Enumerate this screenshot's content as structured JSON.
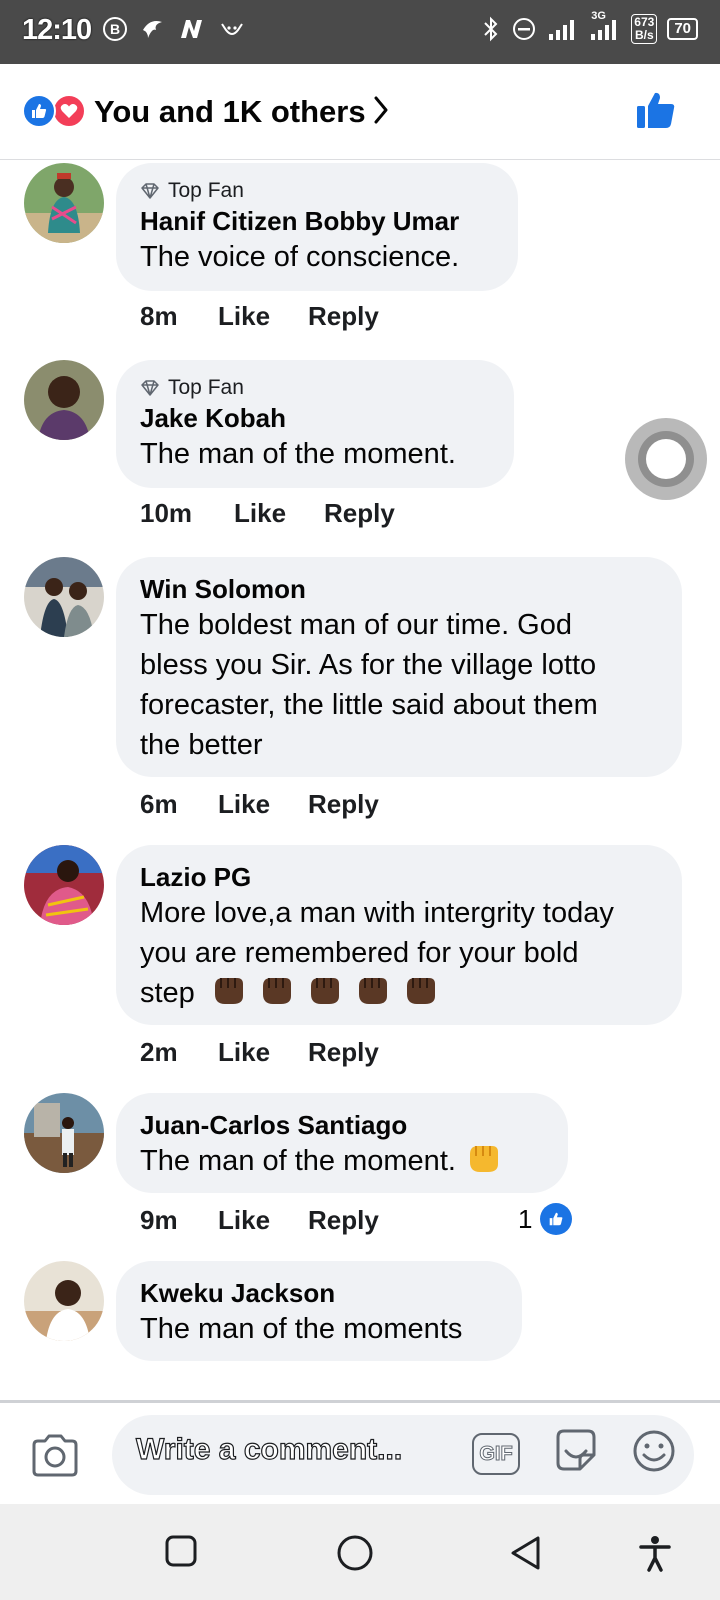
{
  "status_bar": {
    "time": "12:10",
    "network_type": "3G",
    "net_speed_value": "673",
    "net_speed_unit": "B/s",
    "battery": "70"
  },
  "header": {
    "title": "You and 1K others"
  },
  "comments": [
    {
      "badge": "Top Fan",
      "author": "Hanif Citizen Bobby Umar",
      "text": "The voice of conscience.",
      "time": "8m",
      "like": "Like",
      "reply": "Reply"
    },
    {
      "badge": "Top Fan",
      "author": "Jake Kobah",
      "text": "The man of the moment.",
      "time": "10m",
      "like": "Like",
      "reply": "Reply"
    },
    {
      "author": "Win Solomon",
      "text_lines": [
        "The boldest man of our time. God",
        "bless you Sir. As for the village lotto",
        "forecaster, the little said about them",
        "the better"
      ],
      "time": "6m",
      "like": "Like",
      "reply": "Reply"
    },
    {
      "author": "Lazio PG",
      "text_lines": [
        "More love,a man with intergrity today",
        "you are remembered for your bold",
        "step"
      ],
      "time": "2m",
      "like": "Like",
      "reply": "Reply"
    },
    {
      "author": "Juan-Carlos Santiago",
      "text": "The man of the moment.",
      "time": "9m",
      "like": "Like",
      "reply": "Reply",
      "reaction_count": "1"
    },
    {
      "author": "Kweku Jackson",
      "text": "The man of the moments"
    }
  ],
  "composer": {
    "placeholder": "Write a comment...",
    "gif_label": "GIF"
  },
  "colors": {
    "accent": "#1b74e4",
    "love": "#f33e58",
    "bubble_bg": "#f0f2f5"
  }
}
